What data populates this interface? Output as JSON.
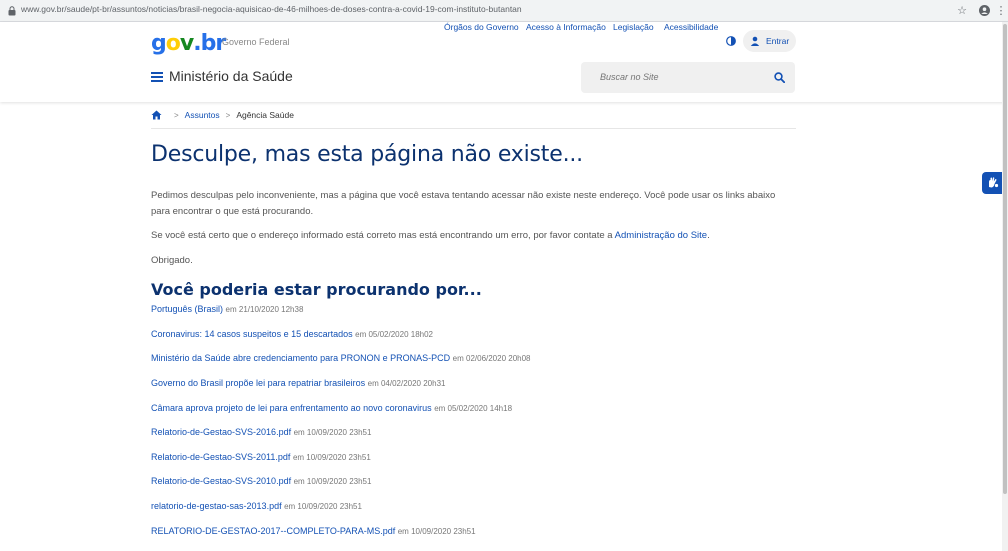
{
  "browser": {
    "url": "www.gov.br/saude/pt-br/assuntos/noticias/brasil-negocia-aquisicao-de-46-milhoes-de-doses-contra-a-covid-19-com-instituto-butantan"
  },
  "header": {
    "logo_text": "gov.br",
    "gov_label": "Governo Federal",
    "links": [
      "Órgãos do Governo",
      "Acesso à Informação",
      "Legislação",
      "Acessibilidade"
    ],
    "entrar_label": "Entrar",
    "site_name": "Ministério da Saúde",
    "search_placeholder": "Buscar no Site"
  },
  "breadcrumb": {
    "items": [
      "Assuntos",
      "Agência Saúde"
    ]
  },
  "main": {
    "title": "Desculpe, mas esta página não existe...",
    "para1": "Pedimos desculpas pelo inconveniente, mas a página que você estava tentando acessar não existe neste endereço. Você pode usar os links abaixo para encontrar o que está procurando.",
    "para2_prefix": "Se você está certo que o endereço informado está correto mas está encontrando um erro, por favor contate a ",
    "para2_link": "Administração do Site",
    "para2_suffix": ".",
    "para3": "Obrigado.",
    "subtitle": "Você poderia estar procurando por...",
    "results": [
      {
        "title": "Português (Brasil)",
        "meta": "em 21/10/2020 12h38"
      },
      {
        "title": "Coronavirus: 14 casos suspeitos e 15 descartados",
        "meta": "em 05/02/2020 18h02"
      },
      {
        "title": "Ministério da Saúde abre credenciamento para PRONON e PRONAS-PCD",
        "meta": "em 02/06/2020 20h08"
      },
      {
        "title": "Governo do Brasil propõe lei para repatriar brasileiros",
        "meta": "em 04/02/2020 20h31"
      },
      {
        "title": "Câmara aprova projeto de lei para enfrentamento ao novo coronavirus",
        "meta": "em 05/02/2020 14h18"
      },
      {
        "title": "Relatorio-de-Gestao-SVS-2016.pdf",
        "meta": "em 10/09/2020 23h51"
      },
      {
        "title": "Relatorio-de-Gestao-SVS-2011.pdf",
        "meta": "em 10/09/2020 23h51"
      },
      {
        "title": "Relatorio-de-Gestao-SVS-2010.pdf",
        "meta": "em 10/09/2020 23h51"
      },
      {
        "title": "relatorio-de-gestao-sas-2013.pdf",
        "meta": "em 10/09/2020 23h51"
      },
      {
        "title": "RELATORIO-DE-GESTAO-2017--COMPLETO-PARA-MS.pdf",
        "meta": "em 10/09/2020 23h51"
      }
    ]
  },
  "colors": {
    "link_blue": "#1351b4",
    "title_blue": "#0c326f",
    "logo_yellow": "#ffcd07",
    "logo_green": "#168821"
  }
}
